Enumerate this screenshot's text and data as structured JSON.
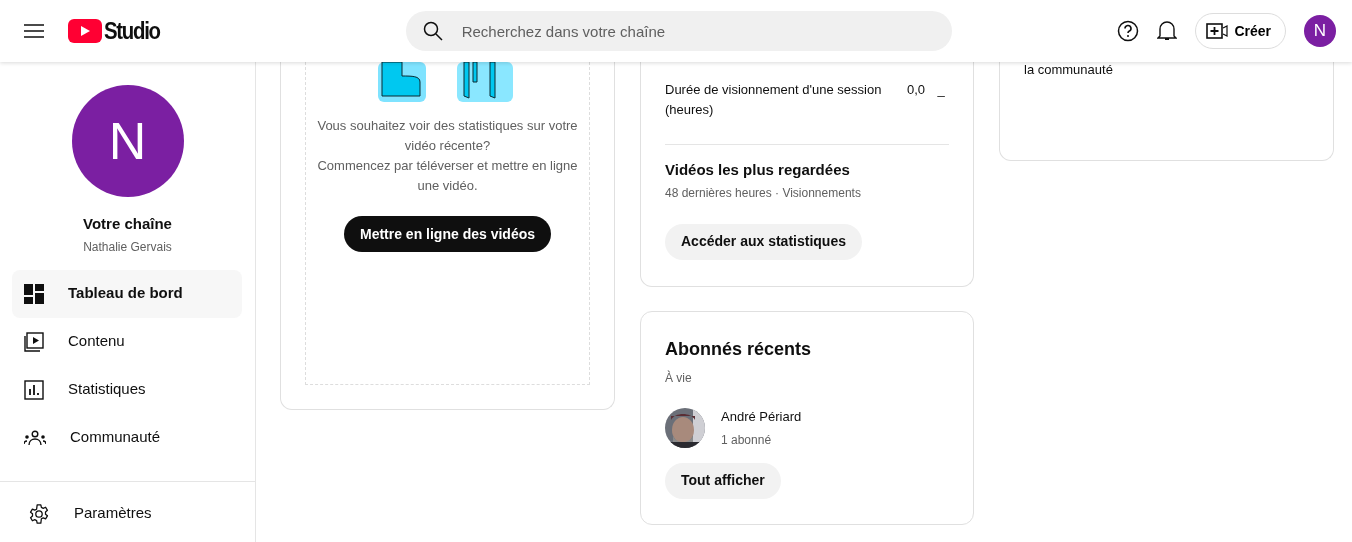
{
  "header": {
    "logo_text": "Studio",
    "search": {
      "placeholder": "Recherchez dans votre chaîne"
    },
    "create_button": "Créer",
    "avatar_letter": "N"
  },
  "sidebar": {
    "avatar_letter": "N",
    "channel_title": "Votre chaîne",
    "channel_name": "Nathalie Gervais",
    "items": [
      {
        "label": "Tableau de bord",
        "selected": true
      },
      {
        "label": "Contenu",
        "selected": false
      },
      {
        "label": "Statistiques",
        "selected": false
      },
      {
        "label": "Communauté",
        "selected": false
      }
    ],
    "footer_item": {
      "label": "Paramètres"
    }
  },
  "upload_card": {
    "lines": [
      "Vous souhaitez voir des statistiques sur votre vidéo récente?",
      "Commencez par téléverser et mettre en ligne une vidéo."
    ],
    "button": "Mettre en ligne des vidéos"
  },
  "stats_card": {
    "metric": {
      "label": "Durée de visionnement d'une session (heures)",
      "value": "0,0",
      "trend": "_"
    },
    "section_title": "Vidéos les plus regardées",
    "section_subtitle": "48 dernières heures · Visionnements",
    "button": "Accéder aux statistiques"
  },
  "subscribers_card": {
    "title": "Abonnés récents",
    "subtitle": "À vie",
    "subscribers": [
      {
        "name": "André Périard",
        "count": "1 abonné"
      }
    ],
    "button": "Tout afficher"
  },
  "community_card": {
    "text": "la communauté"
  }
}
